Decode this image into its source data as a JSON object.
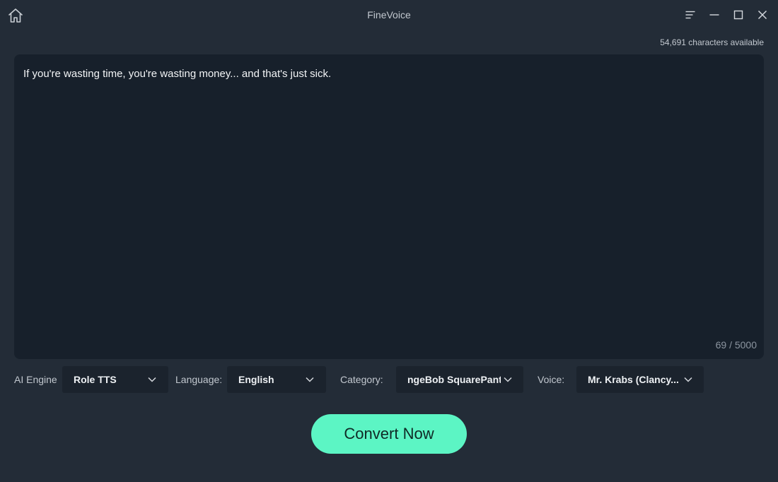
{
  "window": {
    "title": "FineVoice"
  },
  "header": {
    "chars_available": "54,691 characters available"
  },
  "editor": {
    "text": "If you're wasting time, you're wasting money... and that's just sick.",
    "char_count": "69 / 5000"
  },
  "options": {
    "ai_engine_label": "AI Engine",
    "ai_engine_value": "Role TTS",
    "language_label": "Language:",
    "language_value": "English",
    "category_label": "Category:",
    "category_value": "ngeBob SquarePants",
    "voice_label": "Voice:",
    "voice_value": "Mr. Krabs (Clancy..."
  },
  "actions": {
    "convert_label": "Convert Now"
  },
  "colors": {
    "background": "#232c37",
    "editor_bg": "#17202b",
    "dropdown_bg": "#1b232d",
    "accent": "#5cf5c4"
  },
  "icons": [
    "home-icon",
    "menu-icon",
    "minimize-icon",
    "maximize-icon",
    "close-icon",
    "chevron-down-icon"
  ]
}
